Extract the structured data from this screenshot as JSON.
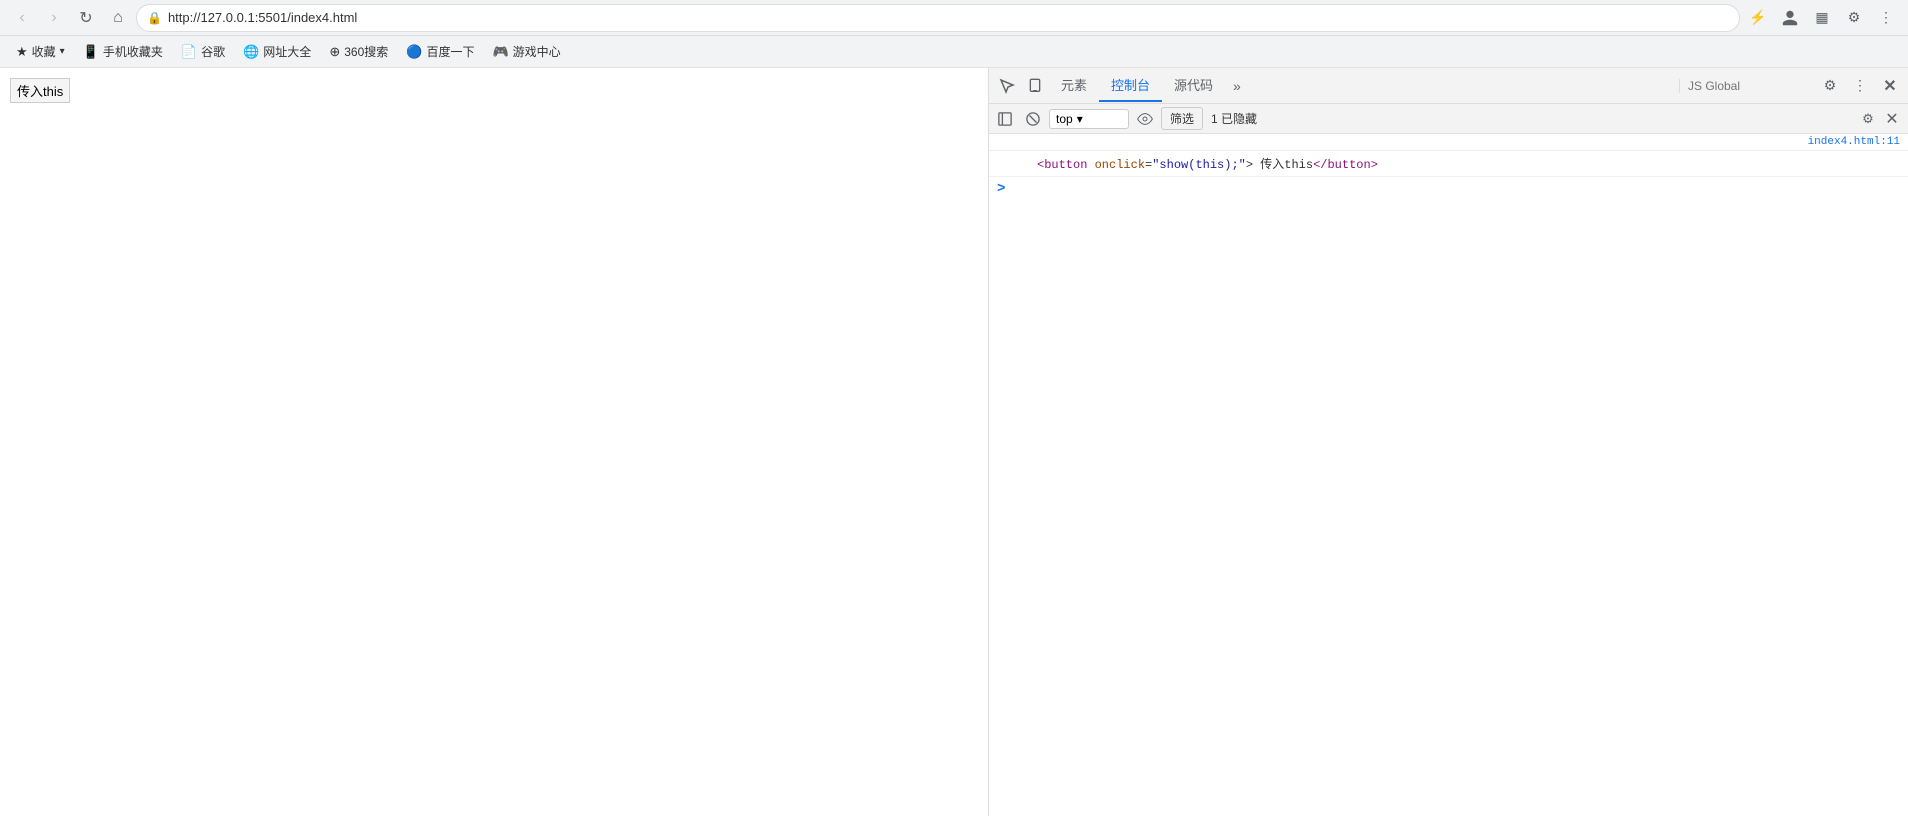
{
  "browser": {
    "url": "http://127.0.0.1:5501/index4.html",
    "back_disabled": true,
    "forward_disabled": true
  },
  "bookmarks": {
    "bar": [
      {
        "id": "collections",
        "icon": "★",
        "label": "收藏",
        "has_dropdown": true
      },
      {
        "id": "mobile",
        "icon": "📱",
        "label": "手机收藏夹"
      },
      {
        "id": "谷歌",
        "icon": "📄",
        "label": "谷歌"
      },
      {
        "id": "wangzhan",
        "icon": "🌐",
        "label": "网址大全"
      },
      {
        "id": "360",
        "icon": "⊕",
        "label": "360搜索"
      },
      {
        "id": "baidu",
        "icon": "🔵",
        "label": "百度一下"
      },
      {
        "id": "games",
        "icon": "🎮",
        "label": "游戏中心"
      }
    ]
  },
  "page": {
    "button_label": "传入this"
  },
  "devtools": {
    "tabs": [
      {
        "id": "elements",
        "label": "元素",
        "active": false
      },
      {
        "id": "console",
        "label": "控制台",
        "active": true
      },
      {
        "id": "sources",
        "label": "源代码",
        "active": false
      }
    ],
    "more_tabs_icon": "»",
    "search_placeholder": "JS Global",
    "console": {
      "context_label": "top",
      "filter_label": "筛选",
      "hidden_count": "1 已隐藏",
      "source_file": "index4.html:11",
      "code_line": "<button onclick=\"show(this);\"> 传入this</button>",
      "code_parts": {
        "open_tag": "<button",
        "attr_name": "onclick",
        "attr_value": "\"show(this);\"",
        "close_bracket": ">",
        "text": " 传入this",
        "close_tag": "</button>"
      },
      "prompt_chevron": ">"
    }
  },
  "icons": {
    "back": "‹",
    "forward": "›",
    "refresh": "↻",
    "home": "⌂",
    "extensions": "🧩",
    "shield": "🛡",
    "person": "👤",
    "cast": "⬡",
    "menu": "⋮",
    "inspect": "↖",
    "device": "📱",
    "no_entry": "⊘",
    "dropdown": "▾",
    "eye": "👁",
    "settings": "⚙",
    "kebab": "⋮",
    "panel_left": "◧",
    "clear": "🚫",
    "collapse": "◂",
    "expand": "▸"
  }
}
